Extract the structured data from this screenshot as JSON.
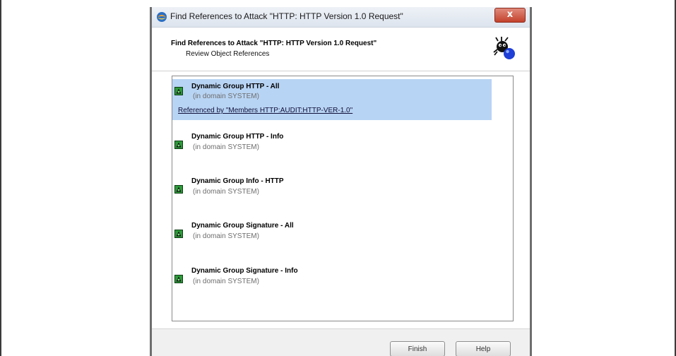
{
  "window": {
    "title": "Find References to Attack \"HTTP: HTTP Version 1.0 Request\"",
    "close_label": "x"
  },
  "header": {
    "title": "Find References to Attack \"HTTP: HTTP Version 1.0 Request\"",
    "subtitle": "Review Object References"
  },
  "references": [
    {
      "name": "Dynamic Group HTTP - All",
      "domain": "(in domain SYSTEM)",
      "referenced_by": "Referenced by \"Members HTTP:AUDIT:HTTP-VER-1.0\"",
      "selected": true
    },
    {
      "name": "Dynamic Group HTTP - Info",
      "domain": "(in domain SYSTEM)"
    },
    {
      "name": "Dynamic Group Info - HTTP",
      "domain": "(in domain SYSTEM)"
    },
    {
      "name": "Dynamic Group Signature - All",
      "domain": "(in domain SYSTEM)"
    },
    {
      "name": "Dynamic Group Signature - Info",
      "domain": "(in domain SYSTEM)"
    }
  ],
  "buttons": {
    "finish": "Finish",
    "help": "Help"
  },
  "colors": {
    "selection": "#b8d4f4",
    "group_icon": "#2e9a3a"
  }
}
